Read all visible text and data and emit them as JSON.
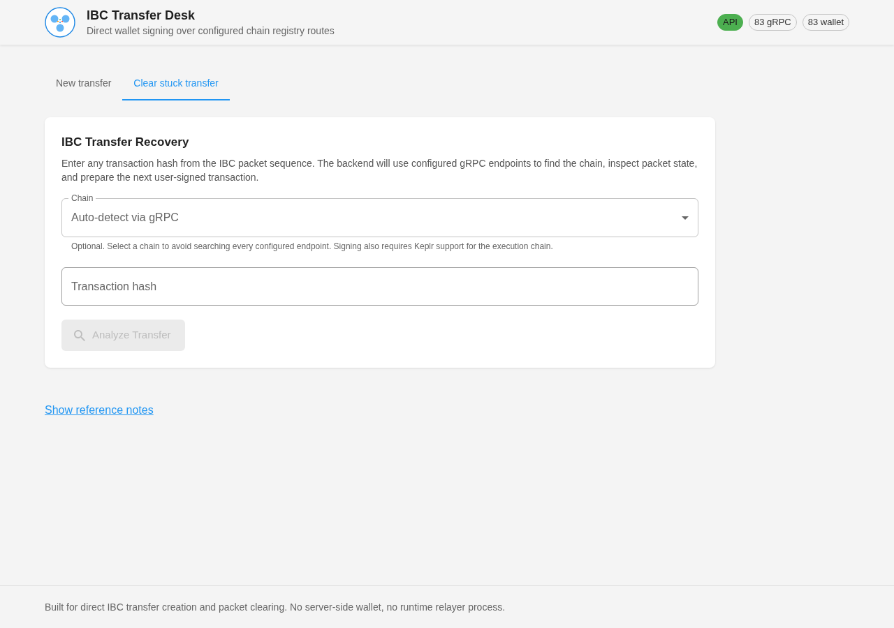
{
  "header": {
    "title": "IBC Transfer Desk",
    "subtitle": "Direct wallet signing over configured chain registry routes",
    "badges": [
      {
        "label": "API",
        "kind": "status"
      },
      {
        "label": "83 gRPC",
        "kind": "count"
      },
      {
        "label": "83 wallet",
        "kind": "count"
      }
    ]
  },
  "tabs": [
    {
      "label": "New transfer",
      "selected": false
    },
    {
      "label": "Clear stuck transfer",
      "selected": true
    }
  ],
  "recovery_card": {
    "title": "IBC Transfer Recovery",
    "description": "Enter any transaction hash from the IBC packet sequence. The backend will use configured gRPC endpoints to find the chain, inspect packet state, and prepare the next user-signed transaction.",
    "chain_select": {
      "label": "Chain",
      "value": "Auto-detect via gRPC",
      "helper_text": "Optional. Select a chain to avoid searching every configured endpoint. Signing also requires Keplr support for the execution chain."
    },
    "hash_field": {
      "placeholder": "Transaction hash"
    },
    "analyze_button": {
      "label": "Analyze Transfer",
      "disabled": true
    }
  },
  "reference_link": "Show reference notes",
  "footer": {
    "text": "Built for direct IBC transfer creation and packet clearing. No server-side wallet, no runtime relayer process."
  }
}
